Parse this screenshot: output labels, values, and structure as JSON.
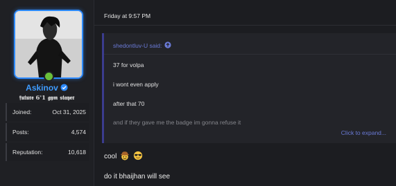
{
  "user": {
    "name": "Askinov",
    "title": "𝖋𝖚𝖙𝖚𝖗𝖊 6'1 𝖌𝖞𝖒 𝖘𝖙𝖆𝖞𝖊𝖗",
    "online_color": "#6bbf3a",
    "name_color": "#3e9bff",
    "verified_icon": "verified-check-icon",
    "stats": [
      {
        "label": "Joined:",
        "value": "Oct 31, 2025"
      },
      {
        "label": "Posts:",
        "value": "4,574"
      },
      {
        "label": "Reputation:",
        "value": "10,618"
      }
    ]
  },
  "message": {
    "date": "Friday at 9:57 PM",
    "quote": {
      "author_said": "shedontluv-U said:",
      "jump_icon": "arrow-up-circle-icon",
      "lines": [
        "37 for volpa",
        "i wont even apply",
        "after that 70",
        "and if they gave me the badge im gonna refuse it"
      ],
      "expand_label": "Click to expand..."
    },
    "reply": {
      "line1": "cool",
      "line1_emojis": [
        "cowboy-face-emoji-icon",
        "sunglasses-face-emoji-icon"
      ],
      "line2": "do it bhaijhan will see"
    }
  },
  "colors": {
    "background": "#1c1d21",
    "accent_blue": "#2e8bff",
    "link": "#6a7ad6"
  }
}
